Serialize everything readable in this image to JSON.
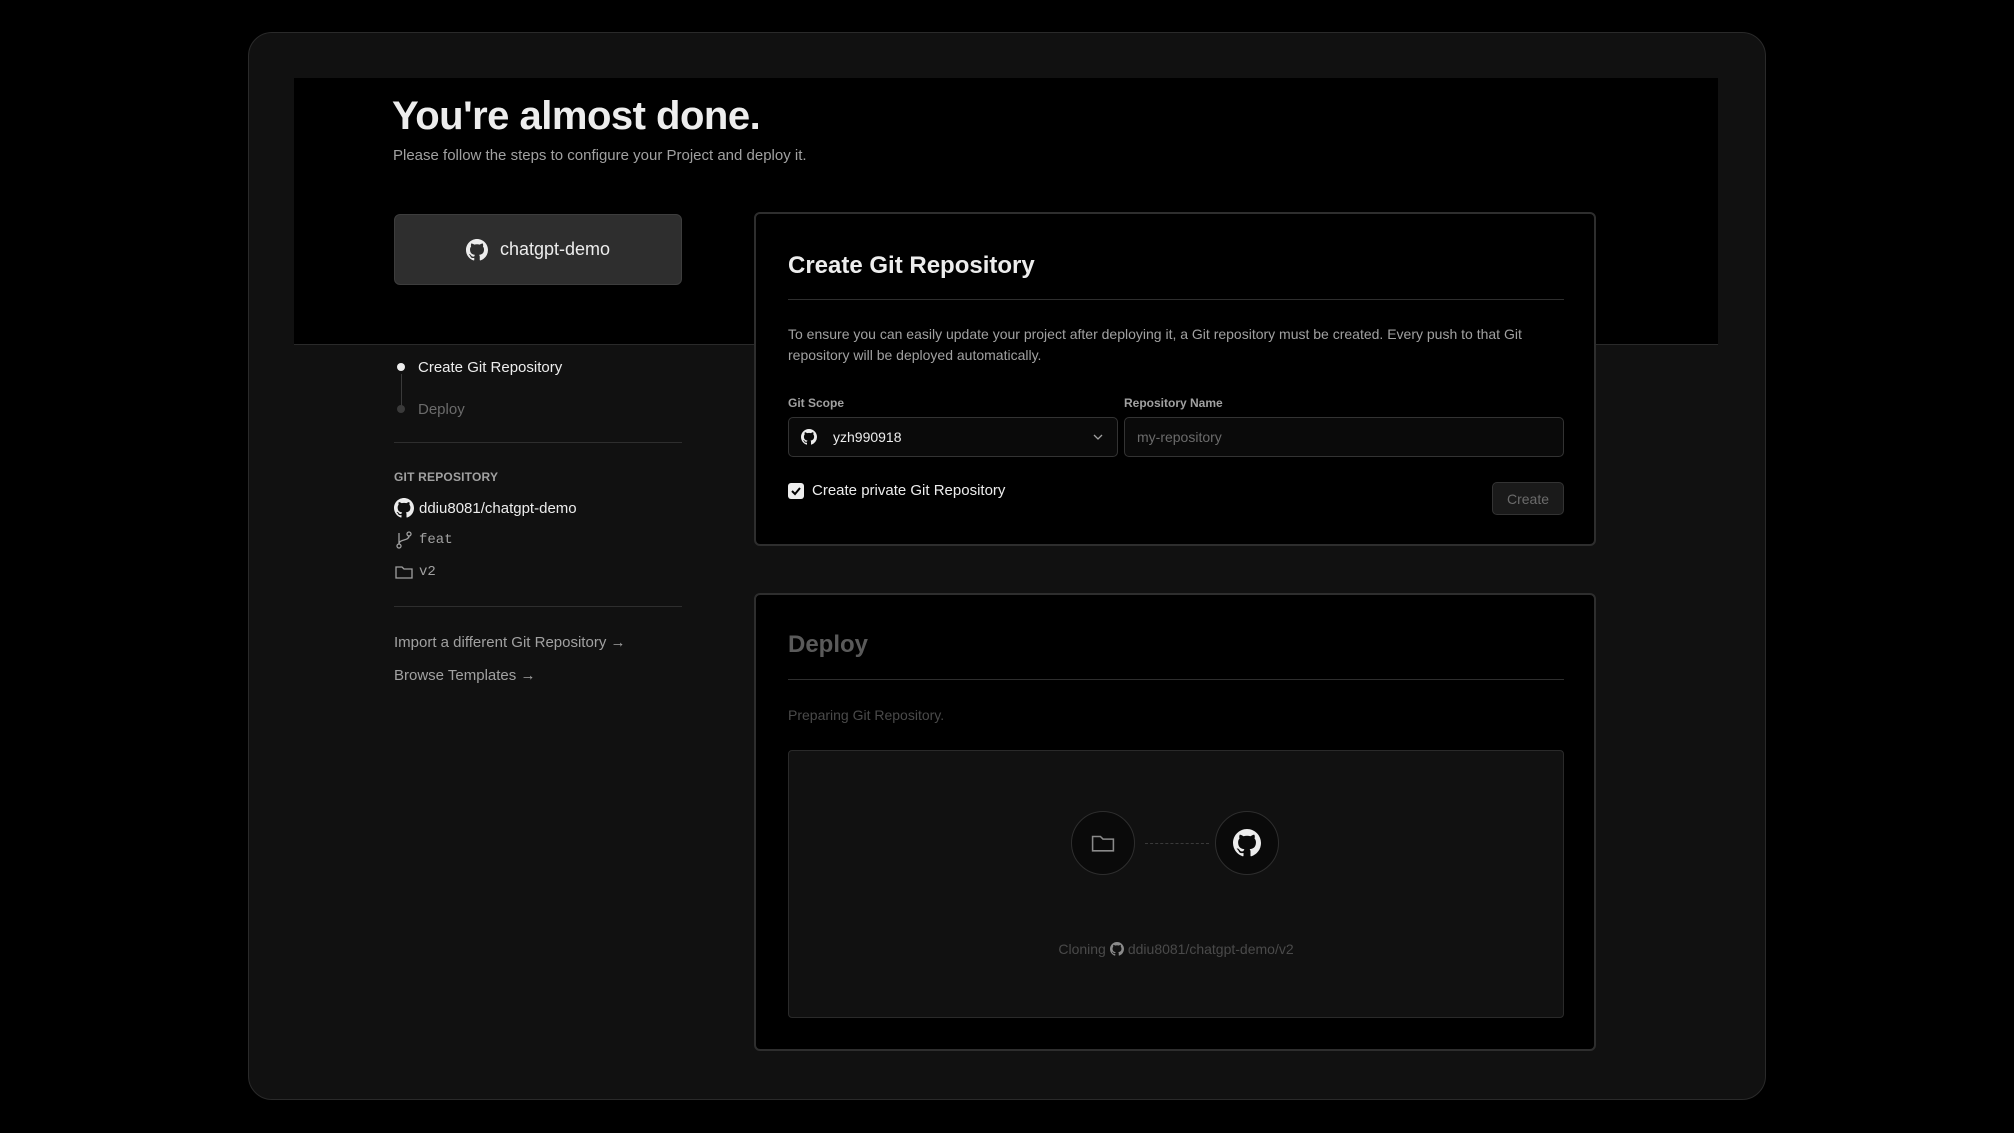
{
  "header": {
    "title": "You're almost done.",
    "subtitle": "Please follow the steps to configure your Project and deploy it."
  },
  "repo_button": {
    "label": "chatgpt-demo",
    "icon": "github-icon"
  },
  "steps": [
    {
      "label": "Create Git Repository",
      "state": "active"
    },
    {
      "label": "Deploy",
      "state": "inactive"
    }
  ],
  "git_repository": {
    "section_label": "GIT REPOSITORY",
    "repo": "ddiu8081/chatgpt-demo",
    "branch": "feat",
    "directory": "v2"
  },
  "links": {
    "import": "Import a different Git Repository →",
    "templates": "Browse Templates →"
  },
  "create_card": {
    "title": "Create Git Repository",
    "description": "To ensure you can easily update your project after deploying it, a Git repository must be created. Every push to that Git repository will be deployed automatically.",
    "scope_label": "Git Scope",
    "scope_value": "yzh990918",
    "repo_name_label": "Repository Name",
    "repo_name_placeholder": "my-repository",
    "private_label": "Create private Git Repository",
    "private_checked": true,
    "create_button": "Create"
  },
  "deploy_card": {
    "title": "Deploy",
    "status": "Preparing Git Repository.",
    "cloning_prefix": "Cloning",
    "cloning_repo": "ddiu8081/chatgpt-demo/v2"
  },
  "colors": {
    "background": "#000000",
    "panel": "#111111",
    "text": "#ededed",
    "muted": "#a1a1a1",
    "button": "#2e2e2e"
  }
}
